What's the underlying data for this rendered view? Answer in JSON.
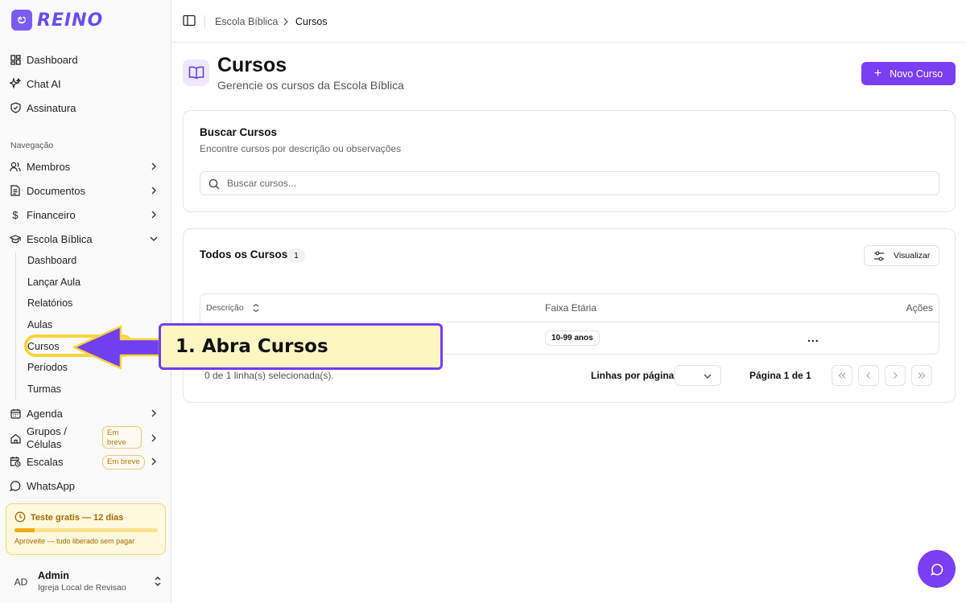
{
  "brand": {
    "name": "REINO",
    "accent": "#7a3ff2"
  },
  "sidebar": {
    "top_items": [
      {
        "label": "Dashboard",
        "icon": "dashboard-grid-icon"
      },
      {
        "label": "Chat AI",
        "icon": "sparkles-icon"
      },
      {
        "label": "Assinatura",
        "icon": "shield-icon"
      }
    ],
    "section_label": "Navegação",
    "nav_items": [
      {
        "label": "Membros",
        "icon": "users-icon"
      },
      {
        "label": "Documentos",
        "icon": "document-icon"
      },
      {
        "label": "Financeiro",
        "icon": "dollar-icon"
      },
      {
        "label": "Escola Bíblica",
        "icon": "graduation-cap-icon"
      }
    ],
    "sub_items": [
      "Dashboard",
      "Lançar Aula",
      "Relatórios",
      "Aulas",
      "Cursos",
      "Períodos",
      "Turmas"
    ],
    "bottom_items": [
      {
        "label": "Agenda",
        "icon": "calendar-icon"
      },
      {
        "label": "Grupos / Células",
        "icon": "home-icon",
        "badge": "Em breve"
      },
      {
        "label": "Escalas",
        "icon": "calendar-clock-icon",
        "badge": "Em breve"
      },
      {
        "label": "WhatsApp",
        "icon": "chat-bubble-icon"
      }
    ],
    "trial": {
      "title": "Teste gratis — 12 dias",
      "subtitle": "Aproveite — tudo liberado sem pagar",
      "progress": 0.14
    },
    "user": {
      "initials": "AD",
      "name": "Admin",
      "org": "Igreja Local de Revisao"
    }
  },
  "header": {
    "breadcrumb": [
      "Escola Bíblica",
      "Cursos"
    ]
  },
  "page": {
    "title": "Cursos",
    "subtitle": "Gerencie os cursos da Escola Bíblica",
    "new_button": "Novo Curso"
  },
  "search_card": {
    "title": "Buscar Cursos",
    "subtitle": "Encontre cursos por descrição ou observações",
    "placeholder": "Buscar cursos..."
  },
  "courses_card": {
    "title": "Todos os Cursos",
    "count": "1",
    "view_button": "Visualizar",
    "columns": [
      "Descrição",
      "Faixa Etária",
      "Ações"
    ],
    "rows": [
      {
        "description": "",
        "age_range": "10-99 anos",
        "actions": "..."
      }
    ],
    "selection_text": "0 de 1 linha(s) selecionada(s).",
    "rows_per_page_label": "Linhas por página",
    "rows_per_page_value": "",
    "page_label": "Página 1 de 1"
  },
  "annotation": {
    "text": "1. Abra Cursos"
  }
}
